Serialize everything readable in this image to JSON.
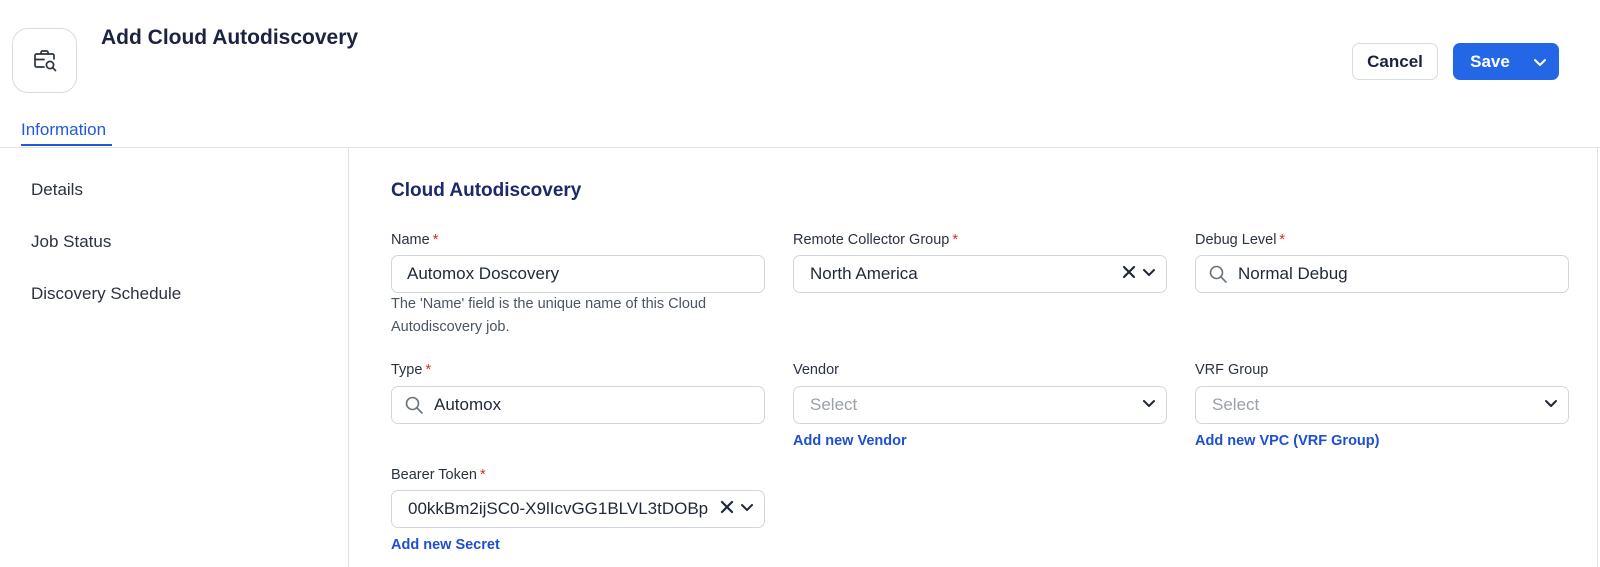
{
  "header": {
    "title": "Add Cloud Autodiscovery",
    "cancel_label": "Cancel",
    "save_label": "Save"
  },
  "tabs": [
    {
      "label": "Information",
      "active": true
    }
  ],
  "sidebar": {
    "items": [
      {
        "label": "Details"
      },
      {
        "label": "Job Status"
      },
      {
        "label": "Discovery Schedule"
      }
    ]
  },
  "form": {
    "section_title": "Cloud Autodiscovery",
    "name": {
      "label": "Name",
      "required_mark": "*",
      "value": "Automox Doscovery",
      "help": "The 'Name' field is the unique name of this Cloud Autodiscovery job."
    },
    "remote_collector_group": {
      "label": "Remote Collector Group",
      "required_mark": "*",
      "value": "North America"
    },
    "debug_level": {
      "label": "Debug Level",
      "required_mark": "*",
      "value": "Normal Debug"
    },
    "type": {
      "label": "Type",
      "required_mark": "*",
      "value": "Automox"
    },
    "vendor": {
      "label": "Vendor",
      "placeholder": "Select",
      "add_link": "Add new Vendor"
    },
    "vrf_group": {
      "label": "VRF Group",
      "placeholder": "Select",
      "add_link": "Add new VPC (VRF Group)"
    },
    "bearer_token": {
      "label": "Bearer Token",
      "required_mark": "*",
      "value": "00kkBm2ijSC0-X9lIcvGG1BLVL3tDOBp",
      "add_link": "Add new Secret"
    }
  },
  "icons": {
    "app": "briefcase-search-icon",
    "search": "search-icon",
    "clear": "clear-icon",
    "chevron": "chevron-down-icon"
  },
  "colors": {
    "primary": "#2467e6",
    "tab_active": "#2359d6",
    "section_title": "#1c2a6b",
    "required": "#d92d20",
    "link": "#1f4fd1"
  }
}
